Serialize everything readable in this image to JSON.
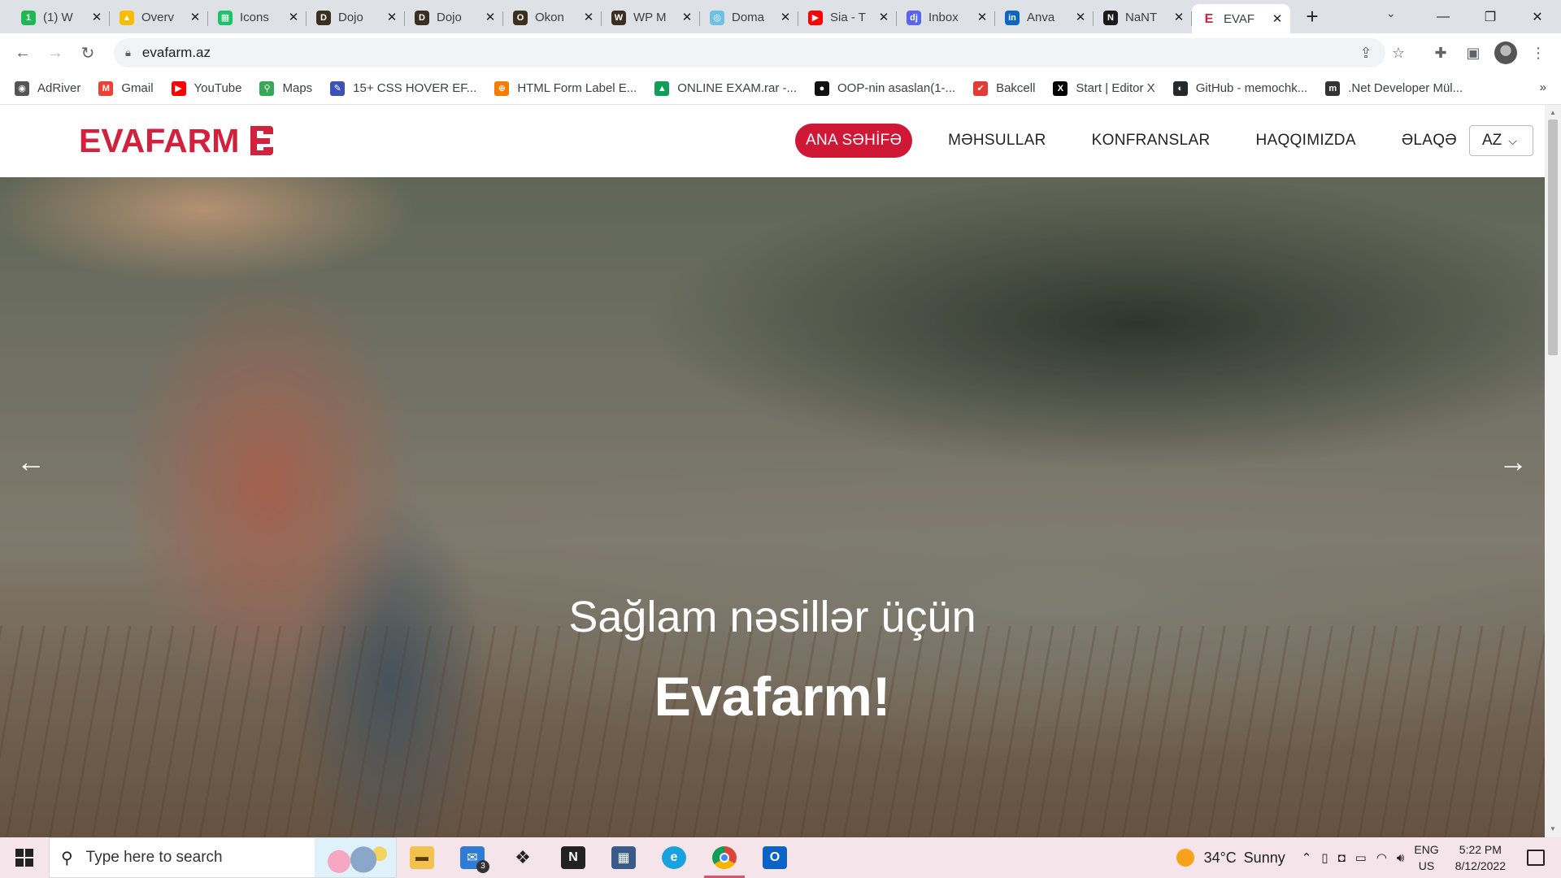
{
  "browser": {
    "tabs": [
      {
        "title": "(1) W",
        "fav_color": "#1db954",
        "fav_glyph": "1"
      },
      {
        "title": "Overv",
        "fav_color": "#fbbc04",
        "fav_glyph": "▲"
      },
      {
        "title": "Icons",
        "fav_color": "#1ec26a",
        "fav_glyph": "▦"
      },
      {
        "title": "Dojo",
        "fav_color": "#3b2f1f",
        "fav_glyph": "D"
      },
      {
        "title": "Dojo",
        "fav_color": "#3b2f1f",
        "fav_glyph": "D"
      },
      {
        "title": "Okon",
        "fav_color": "#3b2f1f",
        "fav_glyph": "O"
      },
      {
        "title": "WP M",
        "fav_color": "#3b2f1f",
        "fav_glyph": "W"
      },
      {
        "title": "Doma",
        "fav_color": "#6ec1e4",
        "fav_glyph": "◎"
      },
      {
        "title": "Sia - T",
        "fav_color": "#ff0000",
        "fav_glyph": "▶"
      },
      {
        "title": "Inbox",
        "fav_color": "#5865f2",
        "fav_glyph": "dj"
      },
      {
        "title": "Anva",
        "fav_color": "#0a66c2",
        "fav_glyph": "in"
      },
      {
        "title": "NaNT",
        "fav_color": "#1a1a1a",
        "fav_glyph": "N"
      },
      {
        "title": "EVAF",
        "fav_color": "#ffffff",
        "fav_glyph": "E",
        "active": true
      }
    ],
    "new_tab": "+",
    "url": "evafarm.az",
    "bookmarks": [
      {
        "label": "AdRiver",
        "color": "#555555",
        "glyph": "◉"
      },
      {
        "label": "Gmail",
        "color": "#ea4335",
        "glyph": "M"
      },
      {
        "label": "YouTube",
        "color": "#ff0000",
        "glyph": "▶"
      },
      {
        "label": "Maps",
        "color": "#34a853",
        "glyph": "⚲"
      },
      {
        "label": "15+ CSS HOVER EF...",
        "color": "#3f51b5",
        "glyph": "✎"
      },
      {
        "label": "HTML Form Label E...",
        "color": "#f57c00",
        "glyph": "⊕"
      },
      {
        "label": "ONLINE EXAM.rar -...",
        "color": "#0f9d58",
        "glyph": "▲"
      },
      {
        "label": "OOP-nin asaslan(1-...",
        "color": "#111111",
        "glyph": "●"
      },
      {
        "label": "Bakcell",
        "color": "#e53935",
        "glyph": "✔"
      },
      {
        "label": "Start | Editor X",
        "color": "#000000",
        "glyph": "X"
      },
      {
        "label": "GitHub - memochk...",
        "color": "#24292e",
        "glyph": "◐"
      },
      {
        "label": ".Net Developer Mül...",
        "color": "#333333",
        "glyph": "m"
      }
    ],
    "bookmarks_more": "»"
  },
  "site": {
    "logo_text": "EVAFARM",
    "brand_color": "#d3213d",
    "nav": [
      {
        "label": "ANA SƏHİFƏ",
        "active": true
      },
      {
        "label": "MƏHSULLAR"
      },
      {
        "label": "KONFRANSLAR"
      },
      {
        "label": "HAQQIMIZDA"
      },
      {
        "label": "ƏLAQƏ"
      }
    ],
    "language": "AZ",
    "hero": {
      "line1": "Sağlam nəsillər üçün",
      "line2": "Evafarm!"
    }
  },
  "taskbar": {
    "search_placeholder": "Type here to search",
    "mail_badge": "3",
    "weather": {
      "temp": "34°C",
      "condition": "Sunny"
    },
    "lang_top": "ENG",
    "lang_bottom": "US",
    "time": "5:22 PM",
    "date": "8/12/2022"
  }
}
